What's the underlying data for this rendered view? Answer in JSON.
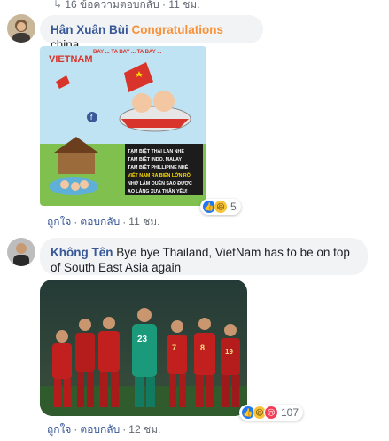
{
  "top": {
    "replies_text": "16 ข้อความตอบกลับ · 11 ชม."
  },
  "comments": [
    {
      "author": "Hân Xuân Bùi",
      "text_highlight": "Congratulations",
      "text_rest": " china .",
      "image_caption_top": "BAY ... TA BAY ... TA BAY ...",
      "image_banner_lines": [
        "TẠM BIỆT THÁI LAN NHÉ",
        "TẠM BIỆT INDO, MALAY",
        "TẠM BIỆT PHILLIPINE NHÉ",
        "VIỆT NAM RA BIỂN LỚN RỒI",
        "NHỚ LẮM QUÊN SAO ĐƯỢC",
        "AO LÀNG XƯA THÂN YÊU!"
      ],
      "image_logo": "VIETNAM",
      "actions": {
        "like": "ถูกใจ",
        "reply": "ตอบกลับ",
        "time": "11 ชม."
      },
      "reaction_count": "5"
    },
    {
      "author": "Không Tên",
      "text": "Bye bye Thailand, VietNam has to be on top of South East Asia again",
      "actions": {
        "like": "ถูกใจ",
        "reply": "ตอบกลับ",
        "time": "12 ชม."
      },
      "reaction_count": "107",
      "players": [
        "23",
        "7",
        "8",
        "19"
      ]
    }
  ],
  "colors": {
    "link": "#385898",
    "accent": "#f7923a",
    "bubble": "#f2f3f5",
    "meta": "#616770"
  }
}
